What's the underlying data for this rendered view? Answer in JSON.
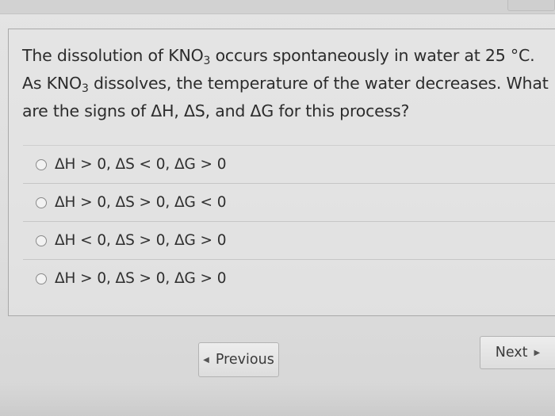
{
  "question": {
    "line1_pre": "The dissolution of KNO",
    "line1_sub": "3",
    "line1_post": " occurs spontaneously in water at 25 °C.",
    "line2_pre": "As KNO",
    "line2_sub": "3",
    "line2_post": " dissolves, the temperature of the water decreases. What",
    "line3": "are the signs of ΔH, ΔS, and ΔG for this process?"
  },
  "options": [
    {
      "label": "ΔH > 0, ΔS < 0, ΔG > 0"
    },
    {
      "label": "ΔH > 0, ΔS > 0, ΔG < 0"
    },
    {
      "label": "ΔH < 0, ΔS > 0, ΔG > 0"
    },
    {
      "label": "ΔH > 0, ΔS > 0, ΔG > 0"
    }
  ],
  "nav": {
    "previous_label": "Previous",
    "next_label": "Next",
    "previous_icon": "triangle-left-icon",
    "next_icon": "triangle-right-icon"
  },
  "colors": {
    "background": "#dcdcdc",
    "text": "#2f2f2f",
    "border": "#a9a9a9"
  }
}
